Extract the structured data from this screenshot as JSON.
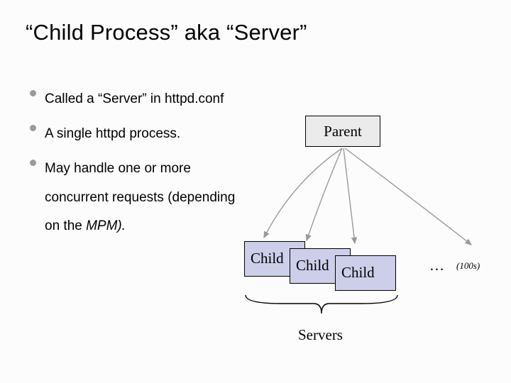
{
  "title": "“Child Process” aka “Server”",
  "bullets": [
    "Called a “Server” in httpd.conf",
    "A single httpd process.",
    "May handle one or more concurrent requests (depending on the "
  ],
  "bullet3_italic": "MPM).",
  "diagram": {
    "parent": "Parent",
    "children": [
      "Child",
      "Child",
      "Child"
    ],
    "ellipsis": "…",
    "hundreds": "(100s)",
    "servers_label": "Servers"
  }
}
